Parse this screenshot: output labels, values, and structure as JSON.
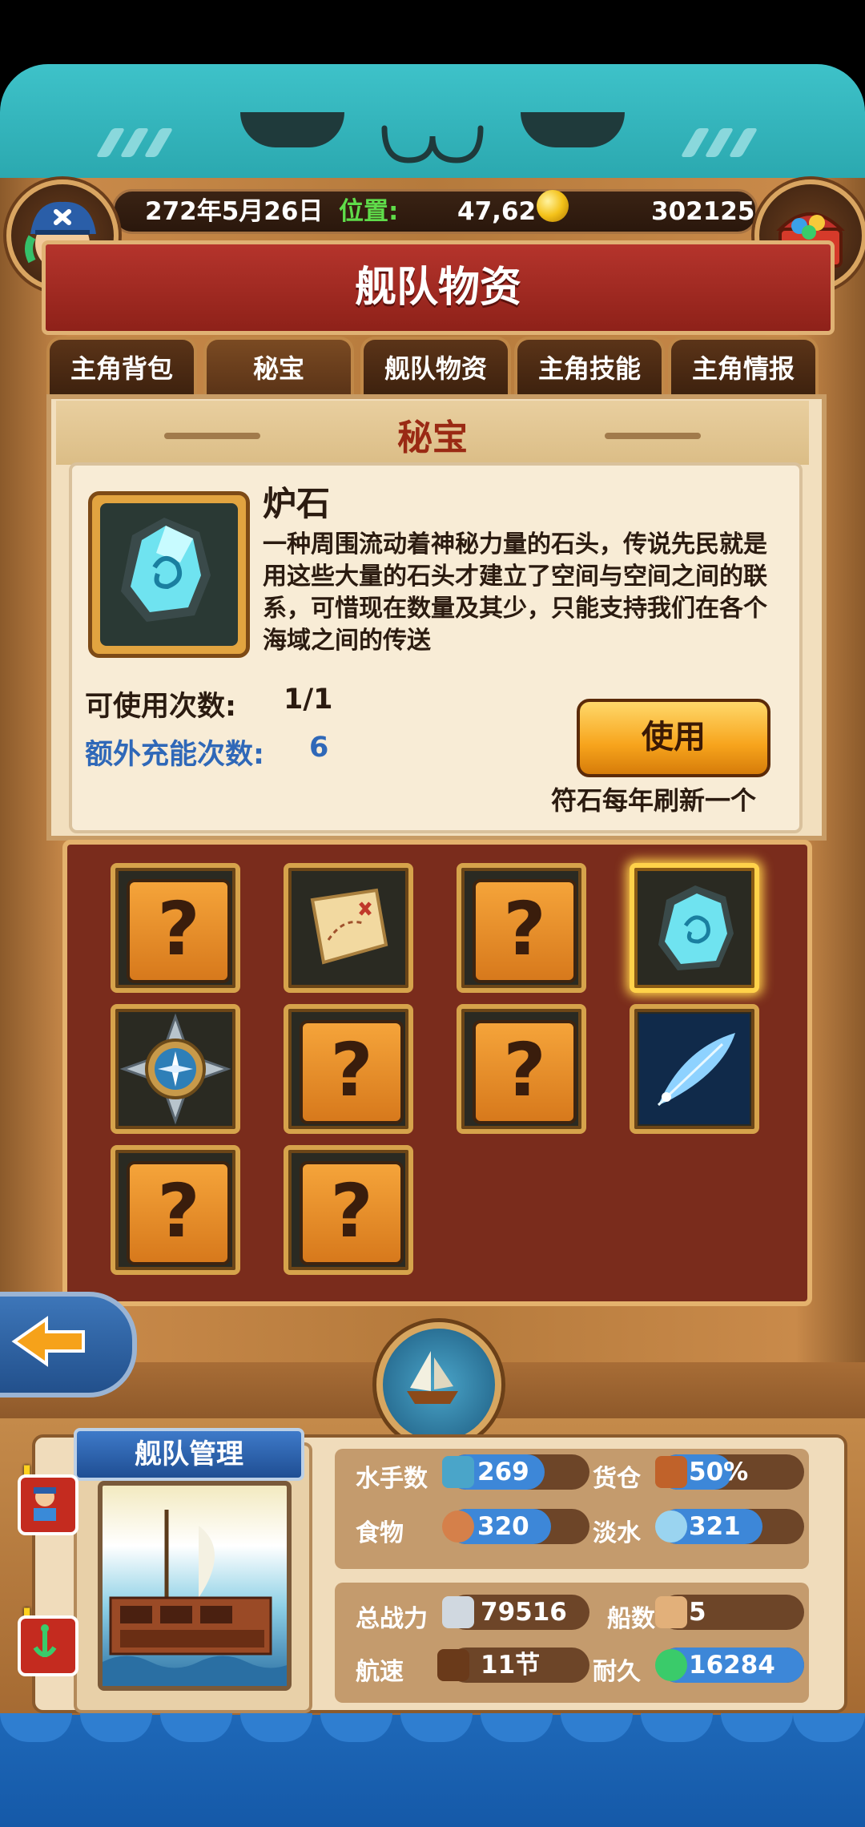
{
  "status_bar": {
    "date": "272年5月26日",
    "position_label": "位置:",
    "position_value": "47,62",
    "gold": "302125"
  },
  "title": "舰队物资",
  "tabs": [
    {
      "label": "主角背包",
      "active": false
    },
    {
      "label": "秘宝",
      "active": true
    },
    {
      "label": "舰队物资",
      "active": false
    },
    {
      "label": "主角技能",
      "active": false
    },
    {
      "label": "主角情报",
      "active": false
    }
  ],
  "section_title": "秘宝",
  "item": {
    "name": "炉石",
    "description": "一种周围流动着神秘力量的石头，传说先民就是用这些大量的石头才建立了空间与空间之间的联系，可惜现在数量及其少，只能支持我们在各个海域之间的传送",
    "uses_label": "可使用次数:",
    "uses_value": "1/1",
    "extra_label": "额外充能次数:",
    "extra_value": "6",
    "use_button": "使用",
    "refresh_note": "符石每年刷新一个"
  },
  "grid": {
    "slots": [
      {
        "type": "unknown",
        "icon": "question-mark-icon"
      },
      {
        "type": "treasure-map",
        "icon": "treasure-map-icon"
      },
      {
        "type": "unknown",
        "icon": "question-mark-icon"
      },
      {
        "type": "hearthstone",
        "icon": "crystal-stone-icon",
        "selected": true
      },
      {
        "type": "compass",
        "icon": "compass-icon"
      },
      {
        "type": "unknown",
        "icon": "question-mark-icon"
      },
      {
        "type": "unknown",
        "icon": "question-mark-icon"
      },
      {
        "type": "feather",
        "icon": "feather-icon"
      },
      {
        "type": "unknown",
        "icon": "question-mark-icon"
      },
      {
        "type": "unknown",
        "icon": "question-mark-icon"
      }
    ],
    "unknown_glyph": "?"
  },
  "fleet": {
    "label": "舰队管理",
    "alert_glyph": "!"
  },
  "stats": {
    "sailors_label": "水手数",
    "sailors_value": "269",
    "cargo_label": "货仓",
    "cargo_value": "50%",
    "cargo_fill": 0.5,
    "food_label": "食物",
    "food_value": "320",
    "water_label": "淡水",
    "water_value": "321",
    "power_label": "总战力",
    "power_value": "79516",
    "ships_label": "船数",
    "ships_value": "5",
    "speed_label": "航速",
    "speed_value": "11节",
    "durability_label": "耐久",
    "durability_value": "16284"
  },
  "colors": {
    "accent_blue": "#2f68b8",
    "title_red": "#b5342c",
    "gold_button": "#f7a41c",
    "section_title": "#9a2a14"
  }
}
